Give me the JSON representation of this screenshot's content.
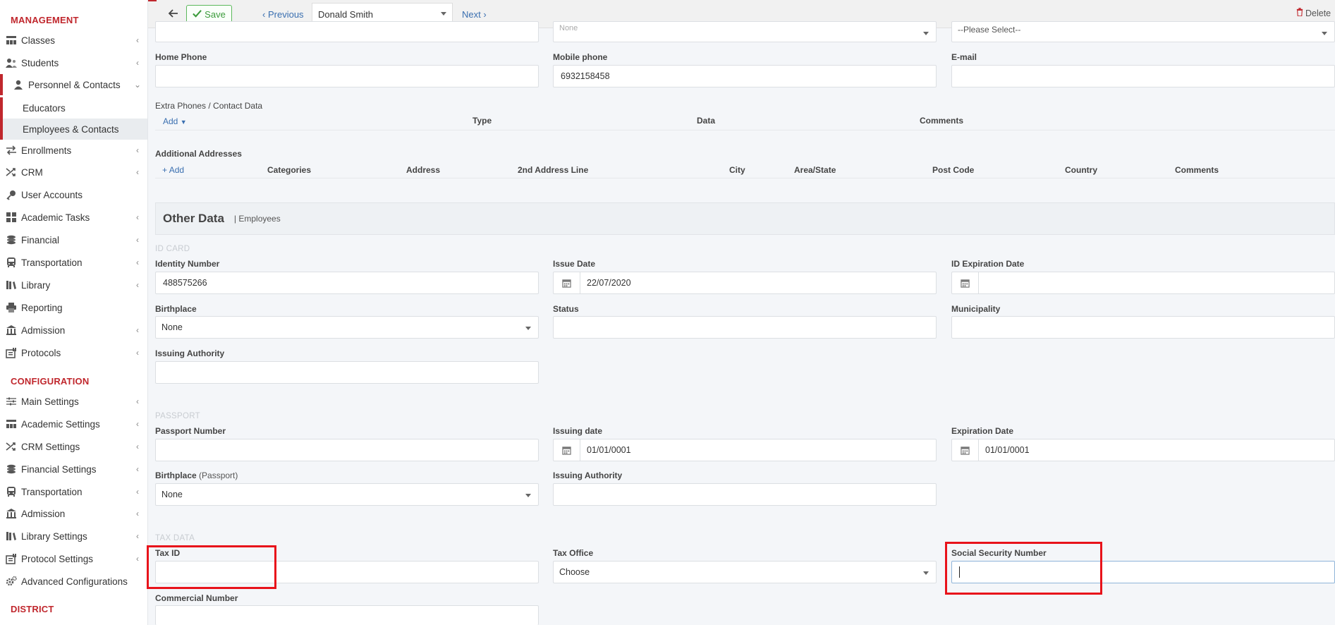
{
  "sidebar": {
    "management_title": "MANAGEMENT",
    "configuration_title": "CONFIGURATION",
    "district_title": "DISTRICT",
    "management_items": [
      {
        "label": "Classes",
        "icon": "classes-icon"
      },
      {
        "label": "Students",
        "icon": "students-icon"
      },
      {
        "label": "Personnel & Contacts",
        "icon": "person-icon"
      },
      {
        "label": "Enrollments",
        "icon": "arrows-icon"
      },
      {
        "label": "CRM",
        "icon": "shuffle-icon"
      },
      {
        "label": "User Accounts",
        "icon": "key-icon"
      },
      {
        "label": "Academic Tasks",
        "icon": "grid-icon"
      },
      {
        "label": "Financial",
        "icon": "coins-icon"
      },
      {
        "label": "Transportation",
        "icon": "bus-icon"
      },
      {
        "label": "Library",
        "icon": "books-icon"
      },
      {
        "label": "Reporting",
        "icon": "printer-icon"
      },
      {
        "label": "Admission",
        "icon": "institution-icon"
      },
      {
        "label": "Protocols",
        "icon": "archive-icon"
      }
    ],
    "personnel_sub": [
      "Educators",
      "Employees & Contacts"
    ],
    "configuration_items": [
      {
        "label": "Main Settings",
        "icon": "sliders-icon"
      },
      {
        "label": "Academic Settings",
        "icon": "classes-icon"
      },
      {
        "label": "CRM Settings",
        "icon": "shuffle-icon"
      },
      {
        "label": "Financial Settings",
        "icon": "coins-icon"
      },
      {
        "label": "Transportation",
        "icon": "bus-icon"
      },
      {
        "label": "Admission",
        "icon": "institution-icon"
      },
      {
        "label": "Library Settings",
        "icon": "books-icon"
      },
      {
        "label": "Protocol Settings",
        "icon": "archive-icon"
      },
      {
        "label": "Advanced Configurations",
        "icon": "gears-icon"
      }
    ]
  },
  "toolbar": {
    "save_label": "Save",
    "previous_label": "Previous",
    "person_selected": "Donald Smith",
    "next_label": "Next",
    "delete_label": "Delete"
  },
  "top_partial": {
    "middle_value": "None",
    "right_value": "--Please Select--"
  },
  "contact": {
    "home_phone_label": "Home Phone",
    "home_phone_value": "",
    "mobile_phone_label": "Mobile phone",
    "mobile_phone_value": "6932158458",
    "email_label": "E-mail",
    "email_value": ""
  },
  "extra_phones": {
    "title": "Extra Phones / Contact Data",
    "add_label": "Add",
    "columns": [
      "Type",
      "Data",
      "Comments"
    ]
  },
  "addresses": {
    "title": "Additional Addresses",
    "add_label": "Add",
    "columns": [
      "Categories",
      "Address",
      "2nd Address Line",
      "City",
      "Area/State",
      "Post Code",
      "Country",
      "Comments"
    ]
  },
  "other_data": {
    "title": "Other Data",
    "subtitle": "| Employees"
  },
  "id_card": {
    "caption": "ID CARD",
    "identity_number_label": "Identity Number",
    "identity_number_value": "488575266",
    "issue_date_label": "Issue Date",
    "issue_date_value": "22/07/2020",
    "id_expiration_label": "ID Expiration Date",
    "id_expiration_value": "",
    "birthplace_label": "Birthplace",
    "birthplace_value": "None",
    "status_label": "Status",
    "status_value": "",
    "municipality_label": "Municipality",
    "municipality_value": "",
    "issuing_authority_label": "Issuing Authority",
    "issuing_authority_value": ""
  },
  "passport": {
    "caption": "PASSPORT",
    "passport_number_label": "Passport Number",
    "passport_number_value": "",
    "issuing_date_label": "Issuing date",
    "issuing_date_value": "01/01/0001",
    "expiration_label": "Expiration Date",
    "expiration_value": "01/01/0001",
    "birthplace_label": "Birthplace",
    "birthplace_suffix": "(Passport)",
    "birthplace_value": "None",
    "issuing_authority_label": "Issuing Authority",
    "issuing_authority_value": ""
  },
  "tax": {
    "caption": "TAX DATA",
    "tax_id_label": "Tax ID",
    "tax_id_value": "",
    "tax_office_label": "Tax Office",
    "tax_office_value": "Choose",
    "ssn_label": "Social Security Number",
    "ssn_value": "",
    "commercial_number_label": "Commercial Number",
    "commercial_number_value": ""
  },
  "colors": {
    "accent_red": "#c0272d",
    "highlight_red": "#e8131b",
    "save_green": "#5cb85c",
    "link_blue": "#3a6fb0"
  }
}
